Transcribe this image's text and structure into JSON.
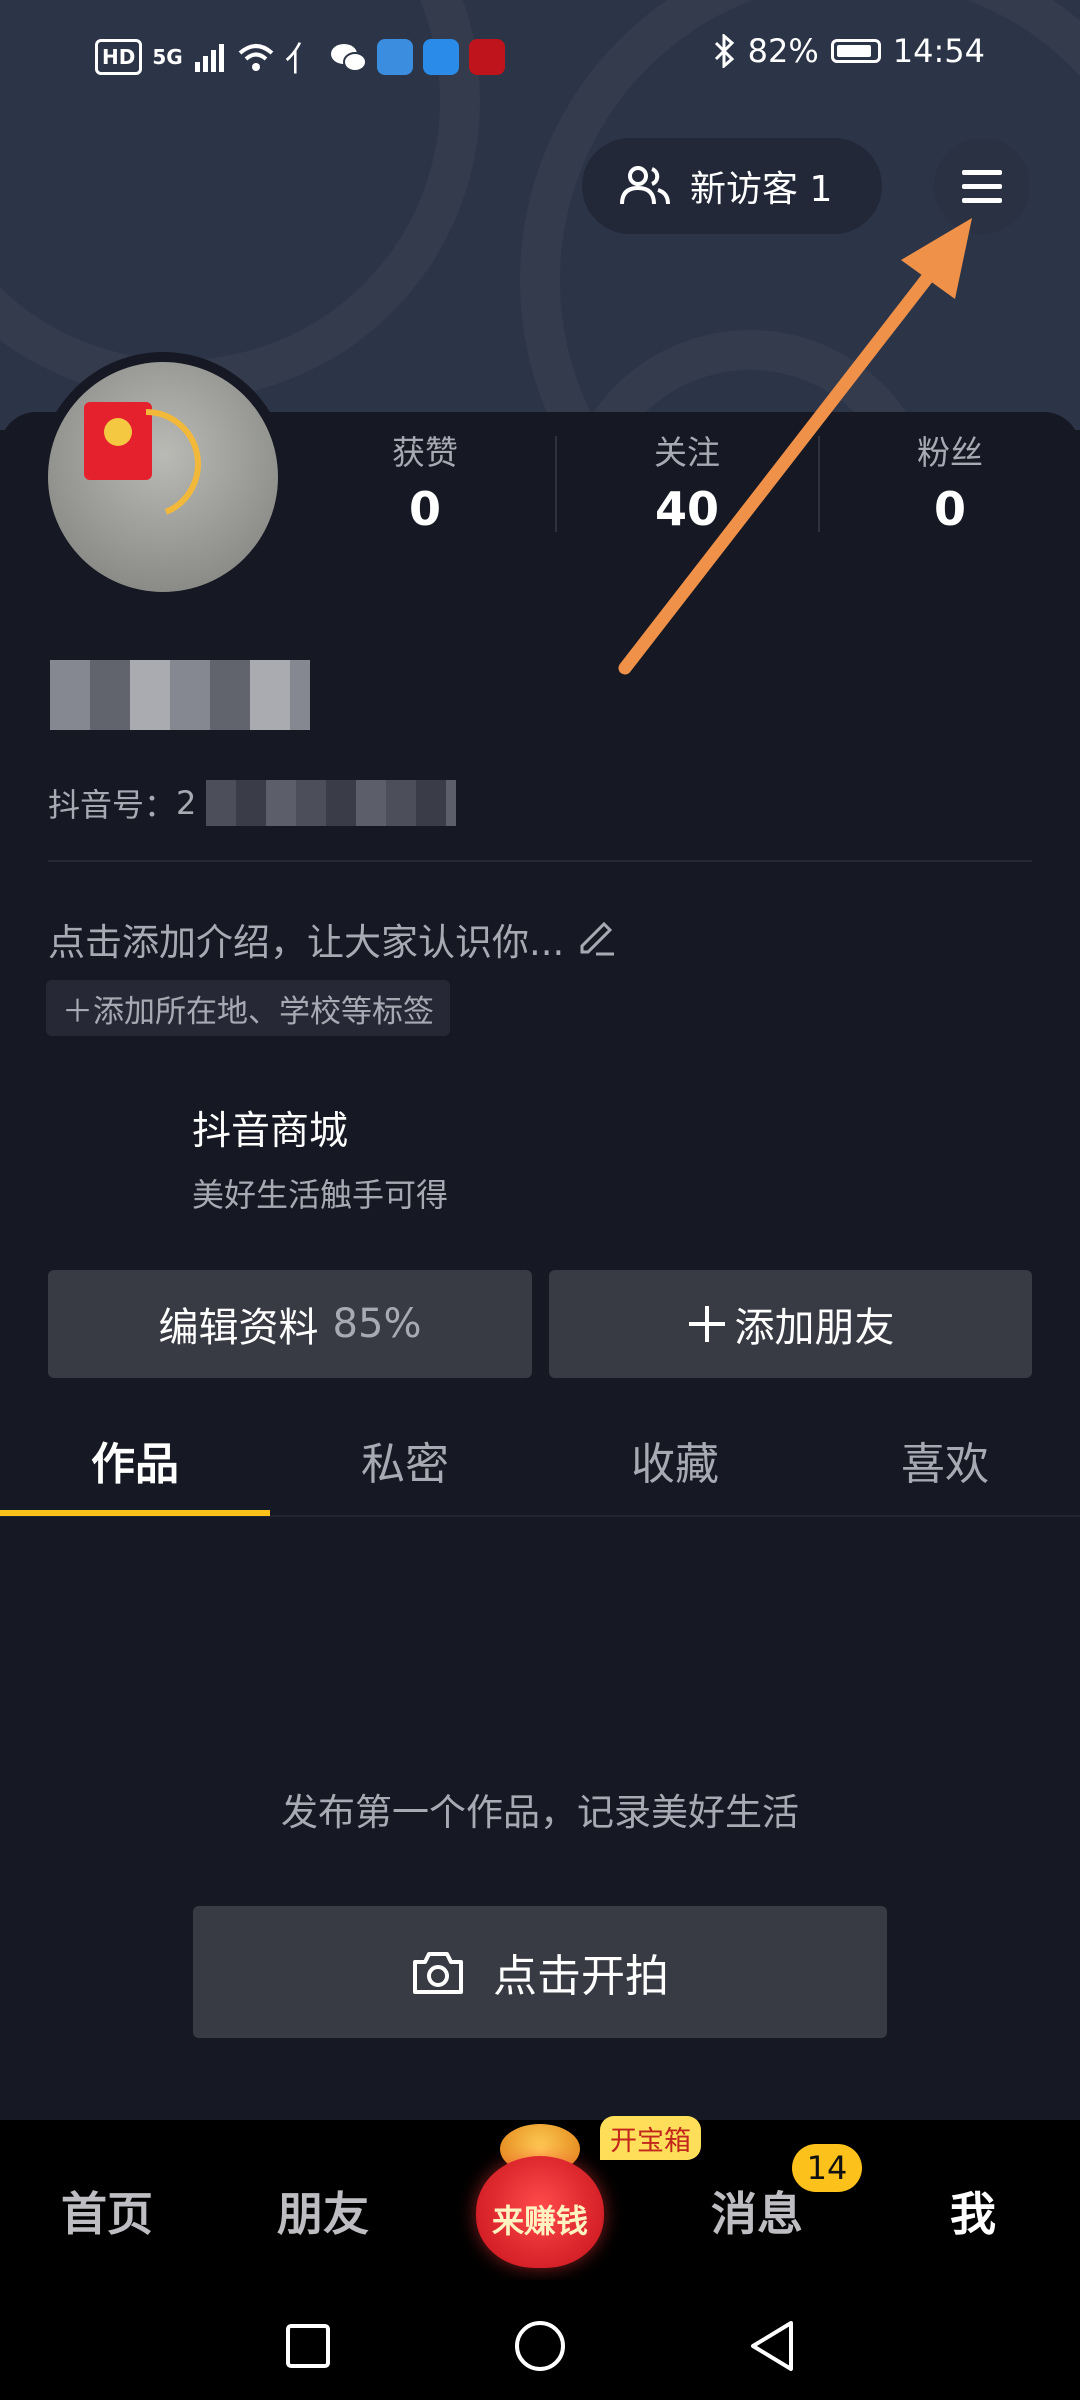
{
  "status_bar": {
    "hd": "HD",
    "network": "5G",
    "battery": "82%",
    "battery_level": 0.82,
    "time": "14:54"
  },
  "header": {
    "visitor_label": "新访客 1"
  },
  "stats": [
    {
      "label": "获赞",
      "value": "0"
    },
    {
      "label": "关注",
      "value": "40"
    },
    {
      "label": "粉丝",
      "value": "0"
    }
  ],
  "profile": {
    "douyin_id_label": "抖音号：",
    "douyin_id_visible": "2"
  },
  "intro": {
    "placeholder": "点击添加介绍，让大家认识你...",
    "tag_chip": "＋添加所在地、学校等标签"
  },
  "shop": {
    "title": "抖音商城",
    "subtitle": "美好生活触手可得"
  },
  "actions": {
    "edit_profile": "编辑资料",
    "completion": "85%",
    "add_friend": "添加朋友"
  },
  "tabs": [
    "作品",
    "私密",
    "收藏",
    "喜欢"
  ],
  "empty": {
    "message": "发布第一个作品，记录美好生活",
    "shoot_button": "点击开拍"
  },
  "bottom_nav": {
    "home": "首页",
    "friends": "朋友",
    "earn": "来赚钱",
    "treasure": "开宝箱",
    "messages": "消息",
    "messages_badge": "14",
    "me": "我"
  },
  "colors": {
    "background": "#161823",
    "accent": "#fdc11c",
    "arrow": "#f0914a"
  }
}
